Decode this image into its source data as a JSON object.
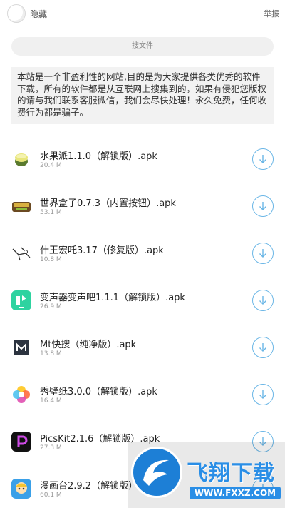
{
  "header": {
    "title": "隐藏",
    "report_label": "举报"
  },
  "search": {
    "label": "搜文件"
  },
  "notice": {
    "text": "本站是一个非盈利性的网站,目的是为大家提供各类优秀的软件下载，所有的软件都是从互联网上搜集到的，如果有侵犯您版权的请与我们联系客服微信，我们会尽快处理！永久免费，任何收费行为都是骗子。"
  },
  "files": [
    {
      "name": "水果派1.1.0（解锁版）.apk",
      "size": "20.4 M",
      "icon": "fruit-icon"
    },
    {
      "name": "世界盒子0.7.3（内置按钮）.apk",
      "size": "53.1 M",
      "icon": "worldbox-icon"
    },
    {
      "name": "什王宏吒3.17（修复版）.apk",
      "size": "10.8 M",
      "icon": "sketch-figure-icon"
    },
    {
      "name": "变声器变声吧1.1.1（解锁版）.apk",
      "size": "26.9 M",
      "icon": "voice-changer-icon"
    },
    {
      "name": "Mt快搜（纯净版）.apk",
      "size": "13.8 M",
      "icon": "mt-search-icon"
    },
    {
      "name": "秀壁纸3.0.0（解锁版）.apk",
      "size": "16.4 M",
      "icon": "flower-icon"
    },
    {
      "name": "PicsKit2.1.6（解锁版）.apk",
      "size": "27.3 M",
      "icon": "picskit-icon"
    },
    {
      "name": "漫画台2.9.2（解锁版）",
      "size": "60.1 M",
      "icon": "manga-icon"
    }
  ],
  "watermark": {
    "brand": "飞翔下载",
    "url": "WWW.FXXZ.COM"
  },
  "colors": {
    "accent": "#6ab6e6",
    "watermark": "#2a8ee6"
  }
}
